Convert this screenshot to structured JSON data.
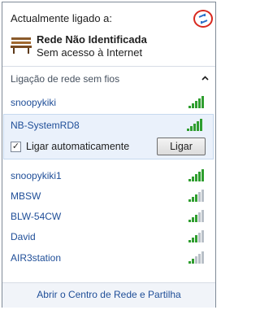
{
  "header": {
    "title": "Actualmente ligado a:",
    "refresh_icon": "refresh-network-icon",
    "highlight_color": "#d8281e"
  },
  "current_network": {
    "icon": "bench-icon",
    "name": "Rede Não Identificada",
    "status": "Sem acesso à Internet"
  },
  "wireless_section": {
    "label": "Ligação de rede sem fios",
    "collapse_glyph": "^"
  },
  "networks": [
    {
      "name": "snoopykiki",
      "signal_bars": 5
    },
    {
      "name": "NB-SystemRD8",
      "signal_bars": 5,
      "selected": true
    },
    {
      "name": "snoopykiki1",
      "signal_bars": 5
    },
    {
      "name": "MBSW",
      "signal_bars": 3
    },
    {
      "name": "BLW-54CW",
      "signal_bars": 3
    },
    {
      "name": "David",
      "signal_bars": 3
    },
    {
      "name": "AIR3station",
      "signal_bars": 2
    }
  ],
  "selected_network": {
    "auto_connect_label": "Ligar automaticamente",
    "auto_connect_checked": "✓",
    "connect_button_label": "Ligar"
  },
  "footer": {
    "link_label": "Abrir o Centro de Rede e Partilha"
  },
  "colors": {
    "link": "#1f4e98",
    "signal_active": "#2f9e2f",
    "signal_inactive": "#b9c0c8",
    "selected_bg": "#eaf1fb"
  }
}
